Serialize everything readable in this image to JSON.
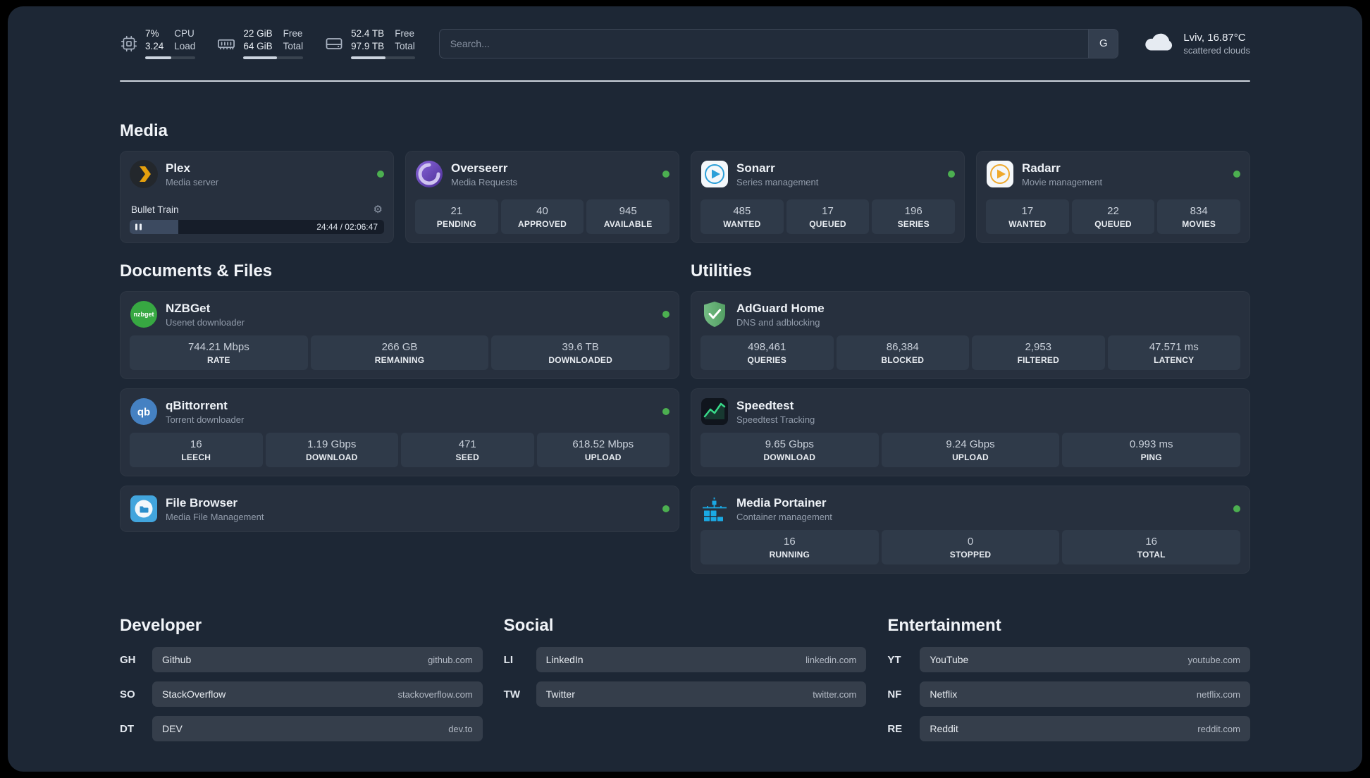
{
  "colors": {
    "status_online": "#4caf50",
    "page_bg": "#1d2735",
    "card_bg": "#27303e",
    "stat_bg": "#2f3a49",
    "plex_accent": "#e5a00d",
    "portainer_blue": "#1aa9e4",
    "adguard_green": "#5fae6f",
    "speedtest_green": "#38d989"
  },
  "glyphs": {
    "gear": "⚙"
  },
  "topbar": {
    "stats": [
      {
        "name": "cpu",
        "v1": "7%",
        "v2": "3.24",
        "l1": "CPU",
        "l2": "Load",
        "progress": 52
      },
      {
        "name": "memory",
        "v1": "22 GiB",
        "v2": "64 GiB",
        "l1": "Free",
        "l2": "Total",
        "progress": 56
      },
      {
        "name": "storage",
        "v1": "52.4 TB",
        "v2": "97.9 TB",
        "l1": "Free",
        "l2": "Total",
        "progress": 54
      }
    ],
    "search": {
      "placeholder": "Search...",
      "engine_button": "G"
    },
    "weather": {
      "location": "Lviv, 16.87°C",
      "condition": "scattered clouds"
    }
  },
  "sections": {
    "media": {
      "title": "Media",
      "apps": [
        {
          "name": "Plex",
          "subtitle": "Media server",
          "player": {
            "track": "Bullet Train",
            "time": "24:44 / 02:06:47",
            "progress": 19
          }
        },
        {
          "name": "Overseerr",
          "subtitle": "Media Requests",
          "stats": [
            {
              "value": "21",
              "label": "PENDING"
            },
            {
              "value": "40",
              "label": "APPROVED"
            },
            {
              "value": "945",
              "label": "AVAILABLE"
            }
          ]
        },
        {
          "name": "Sonarr",
          "subtitle": "Series management",
          "stats": [
            {
              "value": "485",
              "label": "WANTED"
            },
            {
              "value": "17",
              "label": "QUEUED"
            },
            {
              "value": "196",
              "label": "SERIES"
            }
          ]
        },
        {
          "name": "Radarr",
          "subtitle": "Movie management",
          "stats": [
            {
              "value": "17",
              "label": "WANTED"
            },
            {
              "value": "22",
              "label": "QUEUED"
            },
            {
              "value": "834",
              "label": "MOVIES"
            }
          ]
        }
      ]
    },
    "documents": {
      "title": "Documents & Files",
      "apps": [
        {
          "name": "NZBGet",
          "subtitle": "Usenet downloader",
          "stats": [
            {
              "value": "744.21 Mbps",
              "label": "RATE"
            },
            {
              "value": "266 GB",
              "label": "REMAINING"
            },
            {
              "value": "39.6 TB",
              "label": "DOWNLOADED"
            }
          ]
        },
        {
          "name": "qBittorrent",
          "subtitle": "Torrent downloader",
          "stats": [
            {
              "value": "16",
              "label": "LEECH"
            },
            {
              "value": "1.19 Gbps",
              "label": "DOWNLOAD"
            },
            {
              "value": "471",
              "label": "SEED"
            },
            {
              "value": "618.52 Mbps",
              "label": "UPLOAD"
            }
          ]
        },
        {
          "name": "File Browser",
          "subtitle": "Media File Management",
          "stats": []
        }
      ]
    },
    "utilities": {
      "title": "Utilities",
      "apps": [
        {
          "name": "AdGuard Home",
          "subtitle": "DNS and adblocking",
          "stats": [
            {
              "value": "498,461",
              "label": "QUERIES"
            },
            {
              "value": "86,384",
              "label": "BLOCKED"
            },
            {
              "value": "2,953",
              "label": "FILTERED"
            },
            {
              "value": "47.571 ms",
              "label": "LATENCY"
            }
          ]
        },
        {
          "name": "Speedtest",
          "subtitle": "Speedtest Tracking",
          "stats": [
            {
              "value": "9.65 Gbps",
              "label": "DOWNLOAD"
            },
            {
              "value": "9.24 Gbps",
              "label": "UPLOAD"
            },
            {
              "value": "0.993 ms",
              "label": "PING"
            }
          ]
        },
        {
          "name": "Media Portainer",
          "subtitle": "Container management",
          "stats": [
            {
              "value": "16",
              "label": "RUNNING"
            },
            {
              "value": "0",
              "label": "STOPPED"
            },
            {
              "value": "16",
              "label": "TOTAL"
            }
          ]
        }
      ]
    },
    "bookmarks": [
      {
        "title": "Developer",
        "links": [
          {
            "code": "GH",
            "name": "Github",
            "url": "github.com"
          },
          {
            "code": "SO",
            "name": "StackOverflow",
            "url": "stackoverflow.com"
          },
          {
            "code": "DT",
            "name": "DEV",
            "url": "dev.to"
          }
        ]
      },
      {
        "title": "Social",
        "links": [
          {
            "code": "LI",
            "name": "LinkedIn",
            "url": "linkedin.com"
          },
          {
            "code": "TW",
            "name": "Twitter",
            "url": "twitter.com"
          }
        ]
      },
      {
        "title": "Entertainment",
        "links": [
          {
            "code": "YT",
            "name": "YouTube",
            "url": "youtube.com"
          },
          {
            "code": "NF",
            "name": "Netflix",
            "url": "netflix.com"
          },
          {
            "code": "RE",
            "name": "Reddit",
            "url": "reddit.com"
          }
        ]
      }
    ]
  }
}
